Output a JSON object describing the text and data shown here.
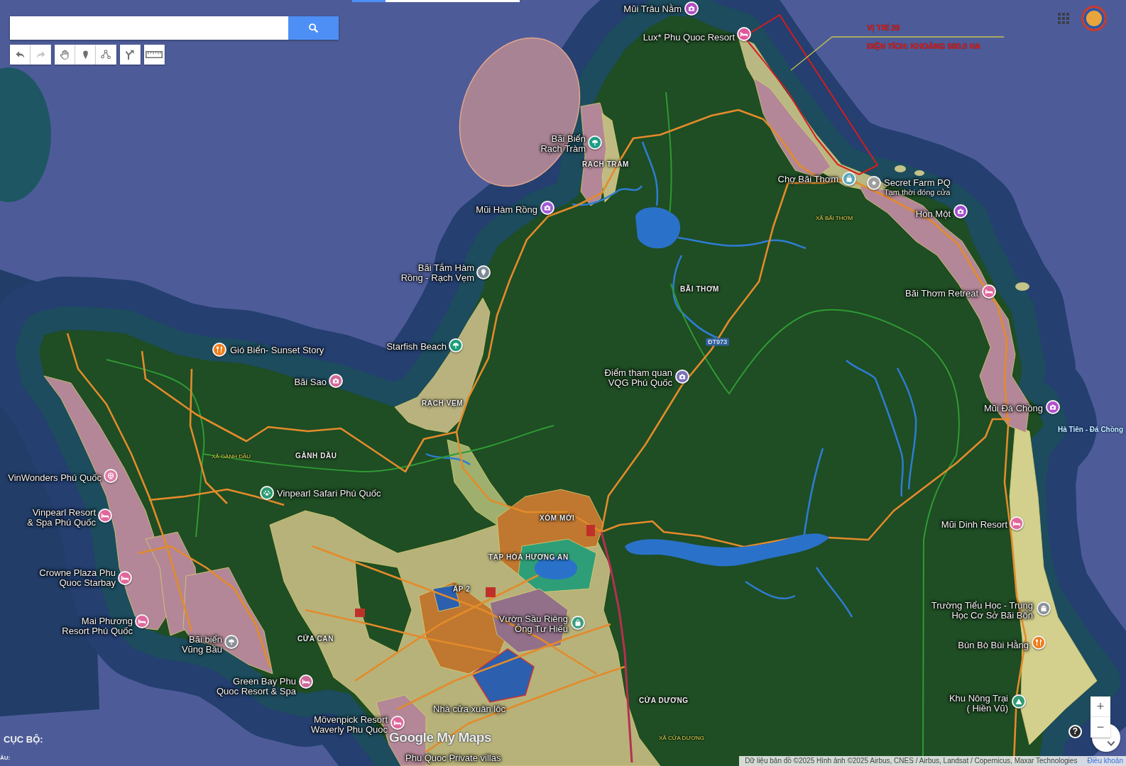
{
  "loading_bar": {
    "level": 0.2
  },
  "toolbar": {
    "groups": [
      {
        "tools": [
          {
            "kind": "undo",
            "disabled": false
          },
          {
            "kind": "redo",
            "disabled": true
          }
        ]
      },
      {
        "tools": [
          {
            "kind": "pan",
            "disabled": false
          },
          {
            "kind": "marker",
            "disabled": false
          },
          {
            "kind": "line",
            "disabled": false
          }
        ]
      },
      {
        "tools": [
          {
            "kind": "directions",
            "disabled": false
          }
        ]
      },
      {
        "tools": [
          {
            "kind": "ruler",
            "disabled": false
          }
        ]
      }
    ]
  },
  "site_annotation": {
    "title": "VỊ TRÍ 20",
    "area": "DIỆN TÍCH: KHOẢNG 500.0 HA"
  },
  "places": [
    {
      "name": "Mũi Trâu Nằm",
      "marker": {
        "kind": "camera",
        "color": "#b04cc4"
      }
    },
    {
      "name": "Lux* Phu Quoc Resort",
      "marker": {
        "kind": "hotel",
        "color": "#e0569a"
      }
    },
    {
      "name": "Bãi Biển Rạch Tràm",
      "marker": {
        "kind": "beach",
        "color": "#1a9e86"
      }
    },
    {
      "name": "Chợ Bãi Thơm",
      "marker": {
        "kind": "bag",
        "color": "#5aa7b8"
      }
    },
    {
      "name": "Secret Farm PQ",
      "note": "Tạm thời đóng cửa",
      "marker": {
        "kind": "dot",
        "color": "#9e9e9e"
      }
    },
    {
      "name": "Mũi Hàm Rồng",
      "marker": {
        "kind": "camera",
        "color": "#a05ad8"
      }
    },
    {
      "name": "Hòn Một",
      "marker": {
        "kind": "camera",
        "color": "#a64ccf"
      }
    },
    {
      "name": "Bãi Tắm Hàm Rồng - Rạch Vẹm",
      "marker": {
        "kind": "pin",
        "color": "#7d8a96"
      }
    },
    {
      "name": "Bãi Thơm Retreat",
      "marker": {
        "kind": "hotel",
        "color": "#e0669c"
      }
    },
    {
      "name": "Gió Biển- Sunset Story",
      "marker": {
        "kind": "food",
        "color": "#f07d1a"
      }
    },
    {
      "name": "Starfish Beach",
      "marker": {
        "kind": "beach",
        "color": "#1a9e7a"
      }
    },
    {
      "name": "Bãi Sao",
      "marker": {
        "kind": "camera",
        "color": "#d06a98"
      }
    },
    {
      "name": "Điểm tham quan VQG Phú Quốc",
      "marker": {
        "kind": "camera",
        "color": "#7a72b8"
      }
    },
    {
      "name": "Mũi Đá Chồng",
      "marker": {
        "kind": "camera",
        "color": "#b050cc"
      }
    },
    {
      "name": "VinWonders Phú Quốc",
      "marker": {
        "kind": "wheel",
        "color": "#e07aa6"
      }
    },
    {
      "name": "Vinpearl Safari Phú Quốc",
      "marker": {
        "kind": "paw",
        "color": "#2e9a72"
      }
    },
    {
      "name": "Vinpearl Resort & Spa Phú Quốc",
      "marker": {
        "kind": "hotel",
        "color": "#e0669c"
      }
    },
    {
      "name": "Mũi Dinh Resort",
      "marker": {
        "kind": "hotel",
        "color": "#e0669c"
      }
    },
    {
      "name": "Crowne Plaza Phu Quoc Starbay",
      "marker": {
        "kind": "hotel",
        "color": "#e0669c"
      }
    },
    {
      "name": "Trường Tiểu Học - Trung Học Cơ Sở Bãi Bổn",
      "marker": {
        "kind": "school",
        "color": "#8a9096"
      }
    },
    {
      "name": "Mai Phương Resort Phú Quốc",
      "marker": {
        "kind": "hotel",
        "color": "#e0669c"
      }
    },
    {
      "name": "Vườn Sầu Riêng Ông Tư Hiếu",
      "marker": {
        "kind": "bag",
        "color": "#3a9e7e"
      }
    },
    {
      "name": "Bãi biển Vũng Bầu",
      "marker": {
        "kind": "beach",
        "color": "#8a9096"
      }
    },
    {
      "name": "Bún Bò Bùi Hằng",
      "marker": {
        "kind": "food",
        "color": "#f07d1a"
      }
    },
    {
      "name": "Green Bay Phu Quoc Resort & Spa",
      "marker": {
        "kind": "hotel",
        "color": "#d0669a"
      }
    },
    {
      "name": "Nhà cửa xuân lộc"
    },
    {
      "name": "Khu Nông Trại ( Hiền Vũ)",
      "marker": {
        "kind": "tent",
        "color": "#2e9a72"
      }
    },
    {
      "name": "Mövenpick Resort Waverly Phu Quoc",
      "marker": {
        "kind": "hotel",
        "color": "#e0669c"
      }
    },
    {
      "name": "Phu Quoc Private villas"
    }
  ],
  "area_labels": [
    {
      "text": "RẠCH TRÀM",
      "kind": "locality"
    },
    {
      "text": "XÃ BÃI THƠM",
      "kind": "commune"
    },
    {
      "text": "BÃI THƠM",
      "kind": "locality"
    },
    {
      "text": "ĐT973",
      "kind": "road"
    },
    {
      "text": "RẠCH VẸM",
      "kind": "locality"
    },
    {
      "text": "Hà Tiên - Đá Chồng",
      "kind": "ferry"
    },
    {
      "text": "GÀNH DẦU",
      "kind": "locality"
    },
    {
      "text": "XÃ GÀNH DẦU",
      "kind": "commune"
    },
    {
      "text": "XÓM MỚI",
      "kind": "locality"
    },
    {
      "text": "TẠP HÓA HƯƠNG AN",
      "kind": "locality"
    },
    {
      "text": "ẤP 2",
      "kind": "locality"
    },
    {
      "text": "CỬA CẠN",
      "kind": "locality"
    },
    {
      "text": "CỬA DƯƠNG",
      "kind": "locality"
    },
    {
      "text": "XÃ CỬA DƯƠNG",
      "kind": "commune"
    }
  ],
  "bottom_left_labels": [
    "CỤC BỘ:",
    "ÂU:"
  ],
  "map_logo": "Google My Maps",
  "help_button": "?",
  "zoom_controls": {
    "zoom_in": "+",
    "zoom_out": "−"
  },
  "attribution": {
    "text": "Dữ liệu bản đồ ©2025 Hình ảnh ©2025 Airbus, CNES / Airbus, Landsat / Copernicus, Maxar Technologies",
    "link": "Điều khoản"
  }
}
